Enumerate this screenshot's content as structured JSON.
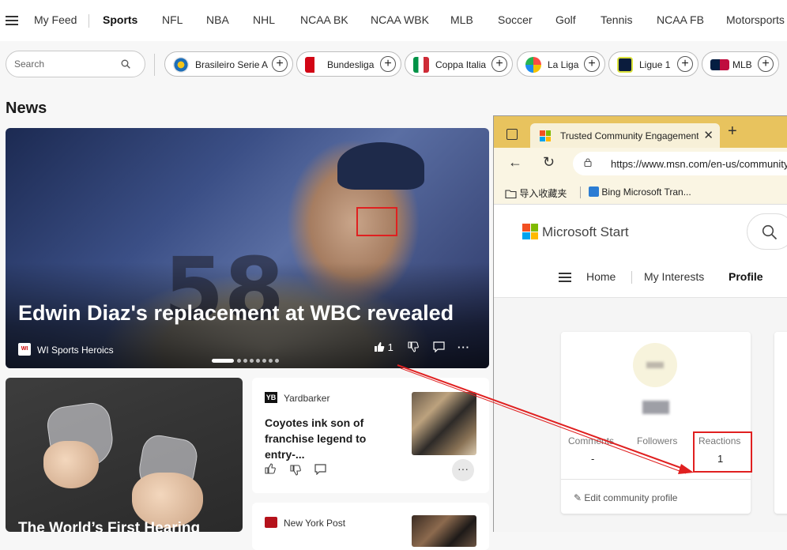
{
  "topnav": {
    "items": [
      "My Feed",
      "Sports",
      "NFL",
      "NBA",
      "NHL",
      "NCAA BK",
      "NCAA WBK",
      "MLB",
      "Soccer",
      "Golf",
      "Tennis",
      "NCAA FB",
      "Motorsports"
    ],
    "active": "Sports"
  },
  "search": {
    "placeholder": "Search"
  },
  "chips": [
    "Brasileiro Serie A",
    "Bundesliga",
    "Coppa Italia",
    "La Liga",
    "Ligue 1",
    "MLB"
  ],
  "news": {
    "heading": "News",
    "hero": {
      "title": "Edwin Diaz's replacement at WBC revealed",
      "source": "WI Sports Heroics",
      "source_logo_text": "WI",
      "jersey_text": "58",
      "like_count": "1"
    },
    "hearing_card": {
      "title": "The World’s First Hearing"
    },
    "coyotes_card": {
      "source": "Yardbarker",
      "source_logo_text": "YB",
      "title": "Coyotes ink son of franchise legend to entry-..."
    },
    "nyp_card": {
      "source": "New York Post"
    }
  },
  "browser": {
    "tab_title": "Trusted Community Engagement",
    "url": "https://www.msn.com/en-us/community",
    "favorites": [
      "导入收藏夹",
      "Bing Microsoft Tran..."
    ],
    "brand": "Microsoft Start",
    "subnav": [
      "Home",
      "My Interests",
      "Profile"
    ],
    "profile": {
      "stats": [
        {
          "label": "Comments",
          "value": "-"
        },
        {
          "label": "Followers",
          "value": ""
        },
        {
          "label": "Reactions",
          "value": "1"
        }
      ],
      "edit_label": "Edit community profile"
    }
  },
  "colors": {
    "highlight": "#e02020",
    "tab_bar": "#e8c35e",
    "ms_red": "#f25022",
    "ms_green": "#7fba00",
    "ms_blue": "#00a4ef",
    "ms_yellow": "#ffb900"
  }
}
